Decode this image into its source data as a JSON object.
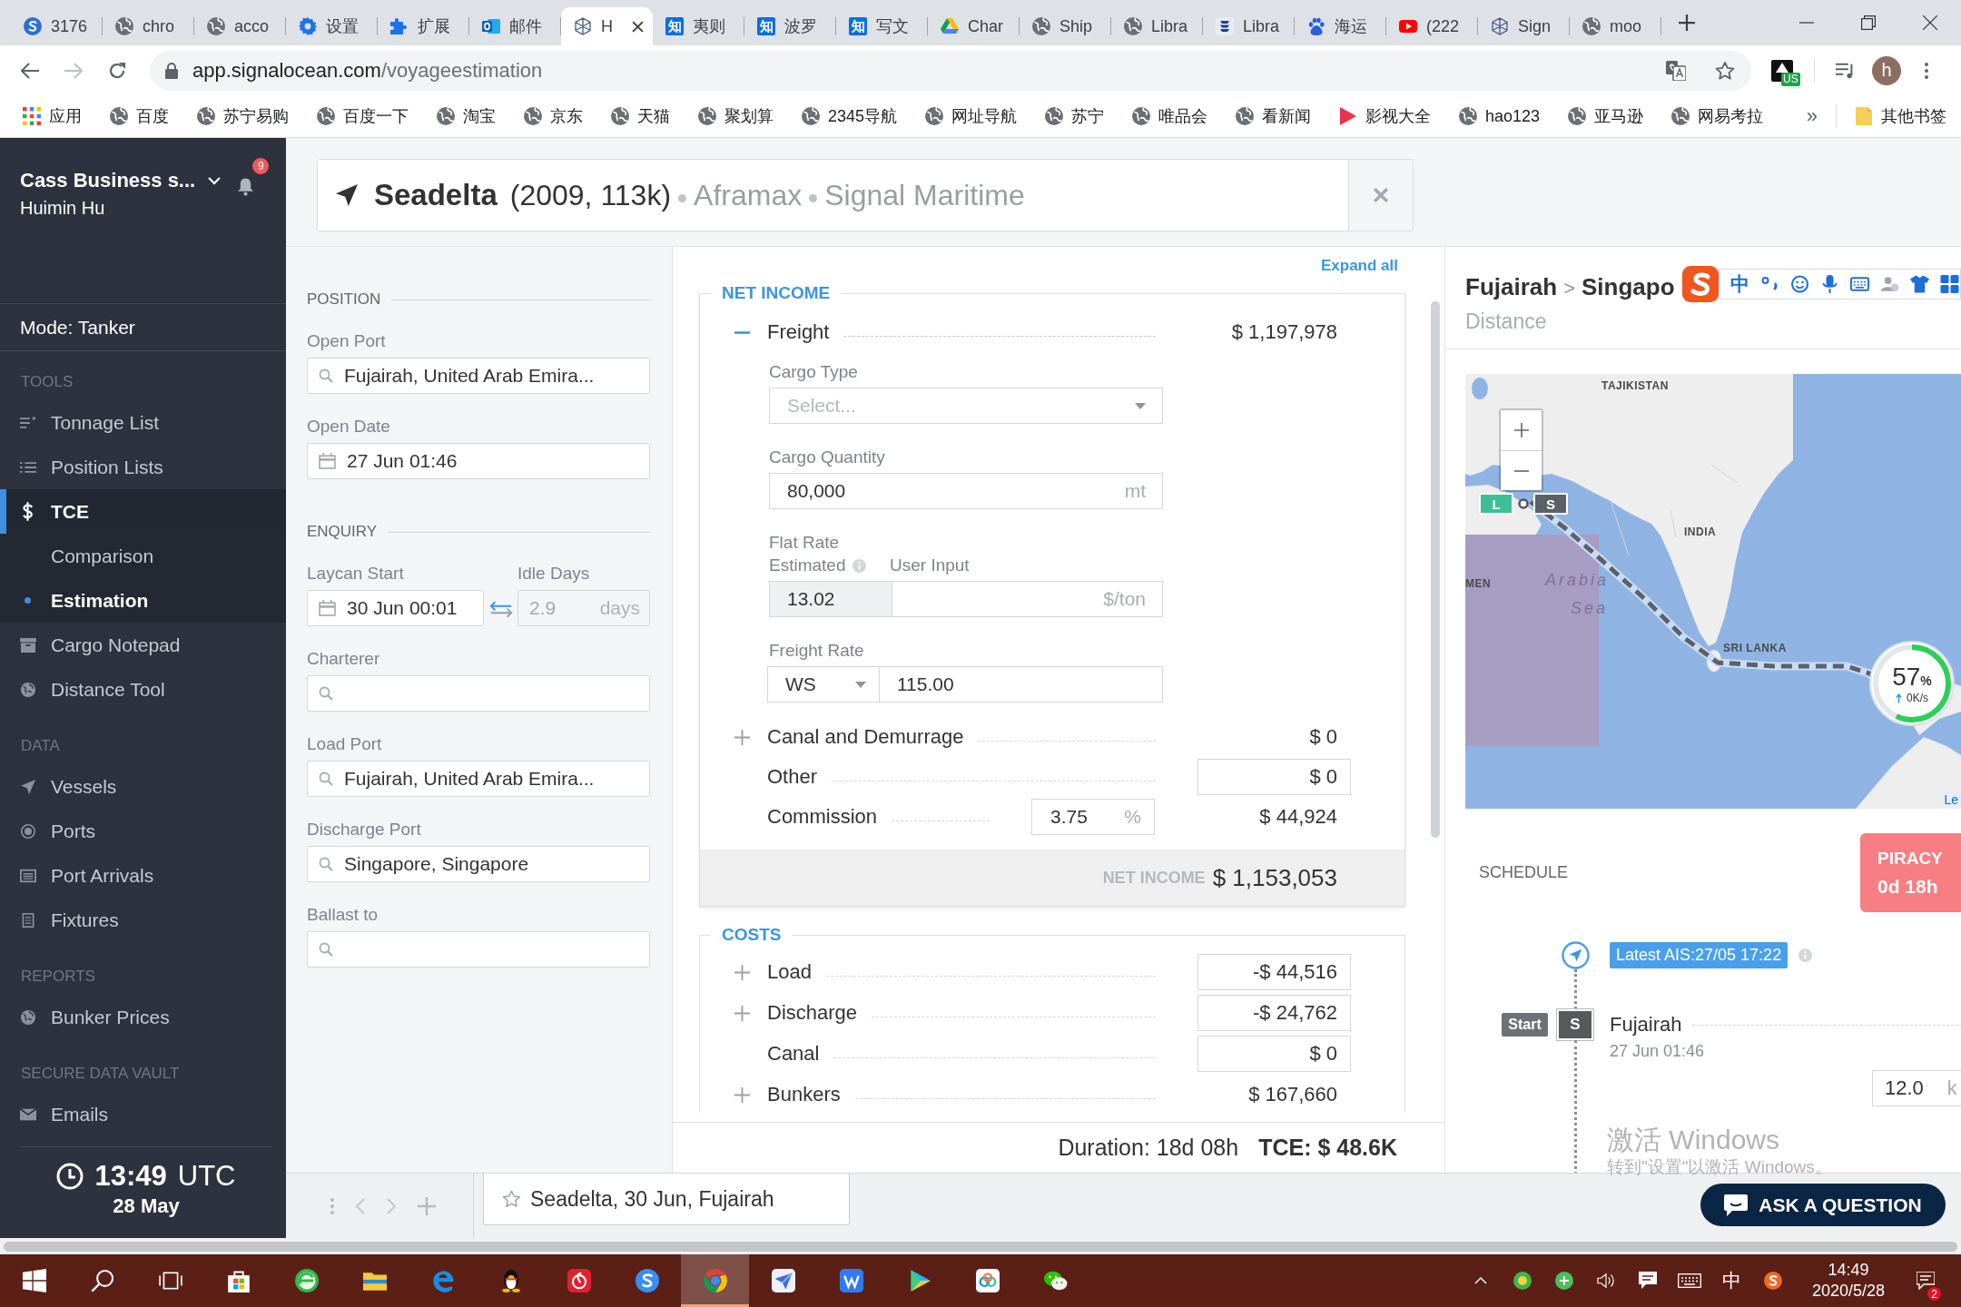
{
  "browser": {
    "tabs": [
      {
        "label": "3176",
        "kind": "sogou",
        "selected": false
      },
      {
        "label": "chro",
        "kind": "globe",
        "selected": false
      },
      {
        "label": "acco",
        "kind": "globe",
        "selected": false
      },
      {
        "label": "设置",
        "kind": "gear",
        "selected": false
      },
      {
        "label": "扩展",
        "kind": "puzzle",
        "selected": false
      },
      {
        "label": "邮件",
        "kind": "outlook",
        "selected": false
      },
      {
        "label": "H",
        "kind": "signal",
        "selected": true
      },
      {
        "label": "夷则",
        "kind": "zhihu",
        "icon_text": "知",
        "selected": false
      },
      {
        "label": "波罗",
        "kind": "zhihu",
        "icon_text": "知",
        "selected": false
      },
      {
        "label": "写文",
        "kind": "zhihu",
        "icon_text": "知",
        "selected": false
      },
      {
        "label": "Char",
        "kind": "drive",
        "selected": false
      },
      {
        "label": "Ship",
        "kind": "globe",
        "selected": false
      },
      {
        "label": "Libra",
        "kind": "globe",
        "selected": false
      },
      {
        "label": "Libra",
        "kind": "stack",
        "selected": false
      },
      {
        "label": "海运",
        "kind": "baidu",
        "selected": false
      },
      {
        "label": "(222",
        "kind": "youtube",
        "selected": false
      },
      {
        "label": "Sign",
        "kind": "signal",
        "selected": false
      },
      {
        "label": "moo",
        "kind": "globe",
        "selected": false
      }
    ],
    "url_host": "app.signalocean.com",
    "url_path": "/voyageestimation",
    "extension_badge": "US",
    "account_initial": "h",
    "bookmarks": [
      {
        "label": "应用",
        "kind": "apps"
      },
      {
        "label": "百度",
        "kind": "globe"
      },
      {
        "label": "苏宁易购",
        "kind": "globe"
      },
      {
        "label": "百度一下",
        "kind": "globe"
      },
      {
        "label": "淘宝",
        "kind": "globe"
      },
      {
        "label": "京东",
        "kind": "globe"
      },
      {
        "label": "天猫",
        "kind": "globe"
      },
      {
        "label": "聚划算",
        "kind": "globe"
      },
      {
        "label": "2345导航",
        "kind": "globe"
      },
      {
        "label": "网址导航",
        "kind": "globe"
      },
      {
        "label": "苏宁",
        "kind": "globe"
      },
      {
        "label": "唯品会",
        "kind": "globe"
      },
      {
        "label": "看新闻",
        "kind": "globe"
      },
      {
        "label": "影视大全",
        "kind": "play"
      },
      {
        "label": "hao123",
        "kind": "globe"
      },
      {
        "label": "亚马逊",
        "kind": "globe"
      },
      {
        "label": "网易考拉",
        "kind": "globe"
      }
    ],
    "more": "»",
    "other_bookmarks": "其他书签"
  },
  "sidebar": {
    "organization": "Cass Business s...",
    "user": "Huimin Hu",
    "notification_count": "9",
    "mode": "Mode: Tanker",
    "sections": [
      {
        "title": "TOOLS",
        "items": [
          {
            "label": "Tonnage List",
            "kind": "lines",
            "selected": false
          },
          {
            "label": "Position Lists",
            "kind": "list",
            "selected": false
          },
          {
            "label": "TCE",
            "kind": "dollar",
            "selected": true,
            "children": [
              {
                "label": "Comparison",
                "selected": false
              },
              {
                "label": "Estimation",
                "selected": true
              }
            ]
          },
          {
            "label": "Cargo Notepad",
            "kind": "archive",
            "selected": false
          },
          {
            "label": "Distance Tool",
            "kind": "globe",
            "selected": false
          }
        ]
      },
      {
        "title": "DATA",
        "items": [
          {
            "label": "Vessels",
            "kind": "arrow",
            "selected": false
          },
          {
            "label": "Ports",
            "kind": "target",
            "selected": false
          },
          {
            "label": "Port Arrivals",
            "kind": "table",
            "selected": false
          },
          {
            "label": "Fixtures",
            "kind": "document",
            "selected": false
          }
        ]
      },
      {
        "title": "REPORTS",
        "items": [
          {
            "label": "Bunker Prices",
            "kind": "globe",
            "selected": false
          }
        ]
      },
      {
        "title": "SECURE DATA VAULT",
        "items": [
          {
            "label": "Emails",
            "kind": "mail",
            "selected": false
          }
        ]
      }
    ],
    "clock": {
      "time": "13:49",
      "zone": "UTC",
      "date": "28 May"
    }
  },
  "vessel": {
    "name": "Seadelta",
    "details": "(2009, 113k)",
    "class": "Aframax",
    "manager": "Signal Maritime"
  },
  "position": {
    "title": "POSITION",
    "fields": [
      {
        "label": "Open Port",
        "kind": "search",
        "value": "Fujairah, United Arab Emira..."
      },
      {
        "label": "Open Date",
        "kind": "date",
        "value": "27 Jun 01:46"
      }
    ]
  },
  "enquiry": {
    "title": "ENQUIRY",
    "laycan_start": {
      "label": "Laycan Start",
      "value": "30 Jun 00:01"
    },
    "idle_days": {
      "label": "Idle Days",
      "value": "2.9",
      "unit": "days",
      "disabled": true
    },
    "fields": [
      {
        "label": "Charterer",
        "kind": "search"
      },
      {
        "label": "Load Port",
        "kind": "search",
        "value": "Fujairah, United Arab Emira..."
      },
      {
        "label": "Discharge Port",
        "kind": "search",
        "value": "Singapore, Singapore"
      },
      {
        "label": "Ballast to",
        "kind": "search"
      }
    ]
  },
  "expand_all": "Expand all",
  "net_income": {
    "title": "NET INCOME",
    "freight": {
      "label": "Freight",
      "expanded": true,
      "value": "$ 1,197,978",
      "cargo_type": {
        "label": "Cargo Type",
        "placeholder": "Select..."
      },
      "cargo_quantity": {
        "label": "Cargo Quantity",
        "value": "80,000",
        "unit": "mt"
      },
      "flat_rate": {
        "label": "Flat Rate",
        "estimated_label": "Estimated",
        "user_input_label": "User Input",
        "estimated": "13.02",
        "unit": "$/ton"
      },
      "freight_rate": {
        "label": "Freight Rate",
        "type": "WS",
        "value": "115.00"
      }
    },
    "lines": [
      {
        "label": "Canal and Demurrage",
        "kind": "text",
        "expandable": true,
        "value": "$ 0"
      },
      {
        "label": "Other",
        "kind": "input",
        "expandable": false,
        "value": "$ 0"
      },
      {
        "label": "Commission",
        "kind": "commission",
        "expandable": false,
        "rate": "3.75",
        "unit": "%",
        "value": "$ 44,924"
      }
    ],
    "total_label": "NET INCOME",
    "total": "$ 1,153,053"
  },
  "costs": {
    "title": "COSTS",
    "lines": [
      {
        "label": "Load",
        "kind": "input",
        "expandable": true,
        "value": "-$ 44,516"
      },
      {
        "label": "Discharge",
        "kind": "input",
        "expandable": true,
        "value": "-$ 24,762"
      },
      {
        "label": "Canal",
        "kind": "input",
        "expandable": false,
        "value": "$ 0"
      },
      {
        "label": "Bunkers",
        "kind": "text",
        "expandable": true,
        "value": "$ 167,660"
      }
    ]
  },
  "summary": {
    "duration": "Duration: 18d 08h",
    "tce": "TCE: $ 48.6K"
  },
  "route": {
    "from": "Fujairah",
    "separator": ">",
    "to": "Singapo",
    "subtitle": "Distance"
  },
  "map": {
    "labels": [
      {
        "text": "TAJIKISTAN",
        "kind": "country"
      },
      {
        "text": "INDIA",
        "kind": "country"
      },
      {
        "text": "Arabia",
        "kind": "sea"
      },
      {
        "text": "Sea",
        "kind": "sea"
      },
      {
        "text": "MEN",
        "kind": "country"
      },
      {
        "text": "SRI LANKA",
        "kind": "country"
      }
    ],
    "markers": [
      {
        "label": "L",
        "color": "#3dbf95"
      },
      {
        "label": "S",
        "color": "#5c6168"
      }
    ],
    "attribution": "Le"
  },
  "schedule": {
    "title": "SCHEDULE",
    "alert": {
      "label": "PIRACY",
      "value": "0d 18h"
    },
    "ais": "Latest AIS:27/05 17:22",
    "stops": [
      {
        "badge": "Start",
        "marker": "S",
        "port": "Fujairah",
        "time": "27 Jun 01:46",
        "speed": "12.0",
        "speed_unit": "k"
      }
    ]
  },
  "workspace_tabs": [
    {
      "label": "Seadelta, 30 Jun, Fujairah",
      "starred": false,
      "selected": true
    }
  ],
  "help_button": "ASK A QUESTION",
  "overlays": {
    "ime_mode": "中",
    "speed_widget": {
      "value": "57",
      "unit": "%",
      "rate": "0K/s",
      "level": 0.57
    },
    "activation": {
      "title": "激活 Windows",
      "hint": "转到\"设置\"以激活 Windows。"
    }
  },
  "taskbar": {
    "buttons": [
      {
        "kind": "start",
        "selected": false
      },
      {
        "kind": "search",
        "selected": false
      },
      {
        "kind": "task_view",
        "selected": false
      },
      {
        "kind": "store",
        "selected": false
      },
      {
        "kind": "browser_e",
        "selected": false
      },
      {
        "kind": "explorer",
        "selected": false
      },
      {
        "kind": "edge",
        "selected": false
      },
      {
        "kind": "penguin",
        "selected": false
      },
      {
        "kind": "music",
        "selected": false
      },
      {
        "kind": "swirl",
        "selected": false
      },
      {
        "kind": "chrome",
        "selected": true
      },
      {
        "kind": "plane",
        "selected": false
      },
      {
        "kind": "wps",
        "selected": false
      },
      {
        "kind": "video",
        "selected": false
      },
      {
        "kind": "cloud",
        "selected": false
      },
      {
        "kind": "chat",
        "selected": false
      }
    ],
    "tray": {
      "ime_mode": "中",
      "time": "14:49",
      "date": "2020/5/28",
      "notification_count": "2"
    }
  }
}
